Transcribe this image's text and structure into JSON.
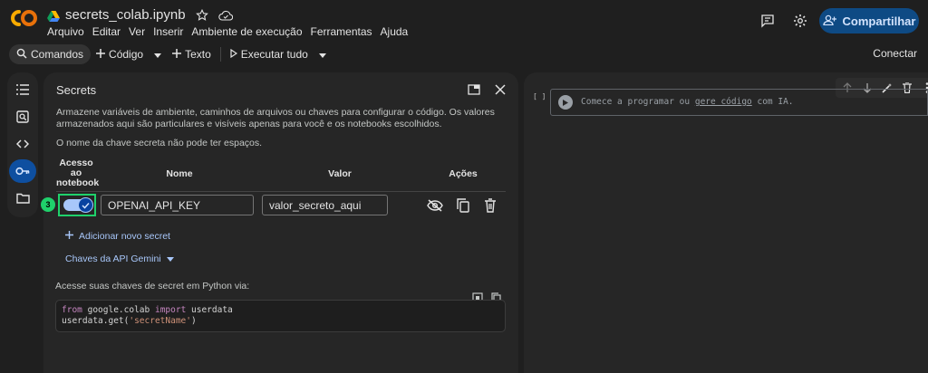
{
  "app": {
    "logo_text": "CO",
    "notebook_title": "secrets_colab.ipynb",
    "menu": [
      "Arquivo",
      "Editar",
      "Ver",
      "Inserir",
      "Ambiente de execução",
      "Ferramentas",
      "Ajuda"
    ],
    "share_label": "Compartilhar",
    "brand_color": "#f9ab00"
  },
  "toolbar": {
    "commands_label": "Comandos",
    "code_label": "Código",
    "text_label": "Texto",
    "run_all_label": "Executar tudo",
    "connect_label": "Conectar"
  },
  "secrets_panel": {
    "title": "Secrets",
    "description": "Armazene variáveis de ambiente, caminhos de arquivos ou chaves para configurar o código. Os valores armazenados aqui são particulares e visíveis apenas para você e os notebooks escolhidos.",
    "note": "O nome da chave secreta não pode ter espaços.",
    "columns": {
      "access_line1": "Acesso",
      "access_line2": "ao",
      "access_line3": "notebook",
      "name": "Nome",
      "value": "Valor",
      "actions": "Ações"
    },
    "secret": {
      "notebook_access": true,
      "name": "OPENAI_API_KEY",
      "value": "valor_secreto_aqui"
    },
    "step_badge": "3",
    "add_label": "Adicionar novo secret",
    "gemini_label": "Chaves da API Gemini",
    "python_note": "Acesse suas chaves de secret em Python via:",
    "code": {
      "line1_kw1": "from",
      "line1_mod": " google.colab ",
      "line1_kw2": "import",
      "line1_name": " userdata",
      "line2_pre": "userdata.get(",
      "line2_str": "'secretName'",
      "line2_post": ")"
    }
  },
  "notebook": {
    "cell_bracket": "[ ]",
    "placeholder_pre": "Comece a programar ou ",
    "placeholder_link": "gere código",
    "placeholder_post": " com IA."
  }
}
